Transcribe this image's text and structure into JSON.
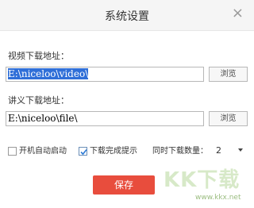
{
  "dialog": {
    "title": "系统设置",
    "close_symbol": "×"
  },
  "video_download": {
    "label": "视频下载地址：",
    "path": "E:\\niceloo\\video\\",
    "browse_label": "浏览"
  },
  "lecture_download": {
    "label": "讲义下载地址：",
    "path": "E:\\niceloo\\file\\",
    "browse_label": "浏览"
  },
  "options": {
    "autostart": {
      "label": "开机自动启动",
      "checked": false
    },
    "download_complete_notice": {
      "label": "下载完成提示",
      "checked": true
    },
    "concurrent_downloads": {
      "label": "同时下载数量：",
      "value": "2"
    }
  },
  "save_label": "保存",
  "watermark": {
    "text": "KK下载",
    "url": "www.kkx.net"
  },
  "colors": {
    "save_button": "#e84d3d",
    "selection": "#2f6fd8",
    "checkbox_tick": "#2d7bd6"
  },
  "icons": {
    "close": "close-icon",
    "checkbox_tick": "check-icon",
    "dropdown": "chevron-down-icon"
  }
}
